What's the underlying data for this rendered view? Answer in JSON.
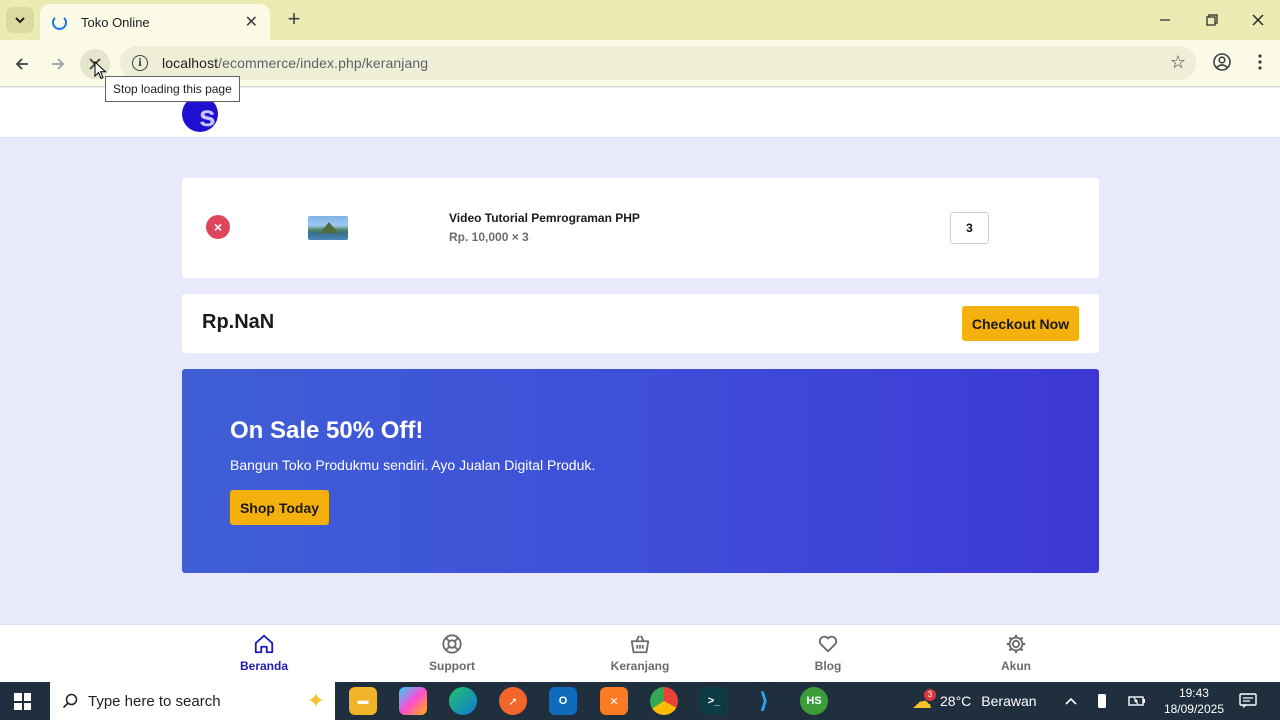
{
  "browser": {
    "tab_title": "Toko Online",
    "url_host": "localhost",
    "url_path": "/ecommerce/index.php/keranjang",
    "tooltip": "Stop loading this page"
  },
  "site": {
    "logo_letter": "s"
  },
  "cart": {
    "remove_symbol": "×",
    "item_name": "Video Tutorial Pemrograman PHP",
    "item_price": "Rp. 10,000 × 3",
    "quantity": "3"
  },
  "summary": {
    "total": "Rp.NaN",
    "checkout_label": "Checkout Now"
  },
  "banner": {
    "title": "On Sale 50% Off!",
    "subtitle": "Bangun Toko Produkmu sendiri. Ayo Jualan Digital Produk.",
    "button_label": "Shop Today"
  },
  "bottom_nav": {
    "items": [
      {
        "label": "Beranda",
        "icon": "home-icon",
        "active": true
      },
      {
        "label": "Support",
        "icon": "lifebuoy-icon",
        "active": false
      },
      {
        "label": "Keranjang",
        "icon": "basket-icon",
        "active": false
      },
      {
        "label": "Blog",
        "icon": "heart-icon",
        "active": false
      },
      {
        "label": "Akun",
        "icon": "gear-icon",
        "active": false
      }
    ]
  },
  "taskbar": {
    "search_placeholder": "Type here to search",
    "weather_temp": "28°C",
    "weather_desc": "Berawan",
    "weather_badge": "3",
    "time": "19:43",
    "date": "18/09/2025",
    "app_hs_label": "HS"
  },
  "colors": {
    "primary": "#1d1ab8",
    "accent": "#f4b00c",
    "danger": "#e0455e",
    "page_bg": "#e8eafb"
  }
}
